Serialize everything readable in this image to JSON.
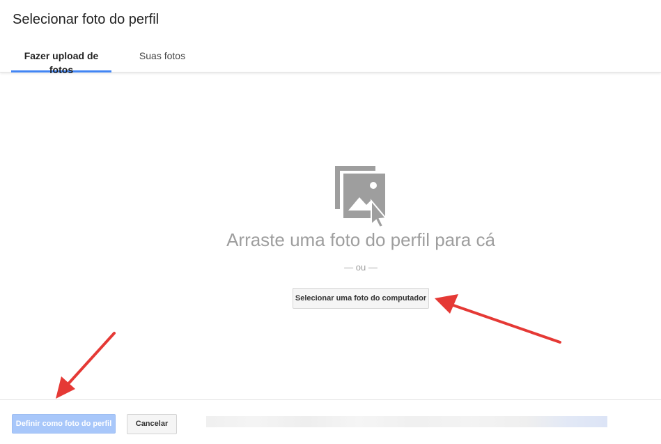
{
  "dialog": {
    "title": "Selecionar foto do perfil"
  },
  "tabs": [
    {
      "label": "Fazer upload de fotos",
      "active": true
    },
    {
      "label": "Suas fotos",
      "active": false
    }
  ],
  "upload": {
    "icon": "image-upload-icon",
    "drop_text": "Arraste uma foto do perfil para cá",
    "or_text": "— ou —",
    "select_button": "Selecionar uma foto do computador"
  },
  "footer": {
    "set_button": "Definir como foto do perfil",
    "cancel_button": "Cancelar"
  },
  "colors": {
    "accent": "#4285f4",
    "disabled_button": "#a8c7fa",
    "annotation_arrow": "#e53935",
    "muted_text": "#9e9e9e"
  }
}
